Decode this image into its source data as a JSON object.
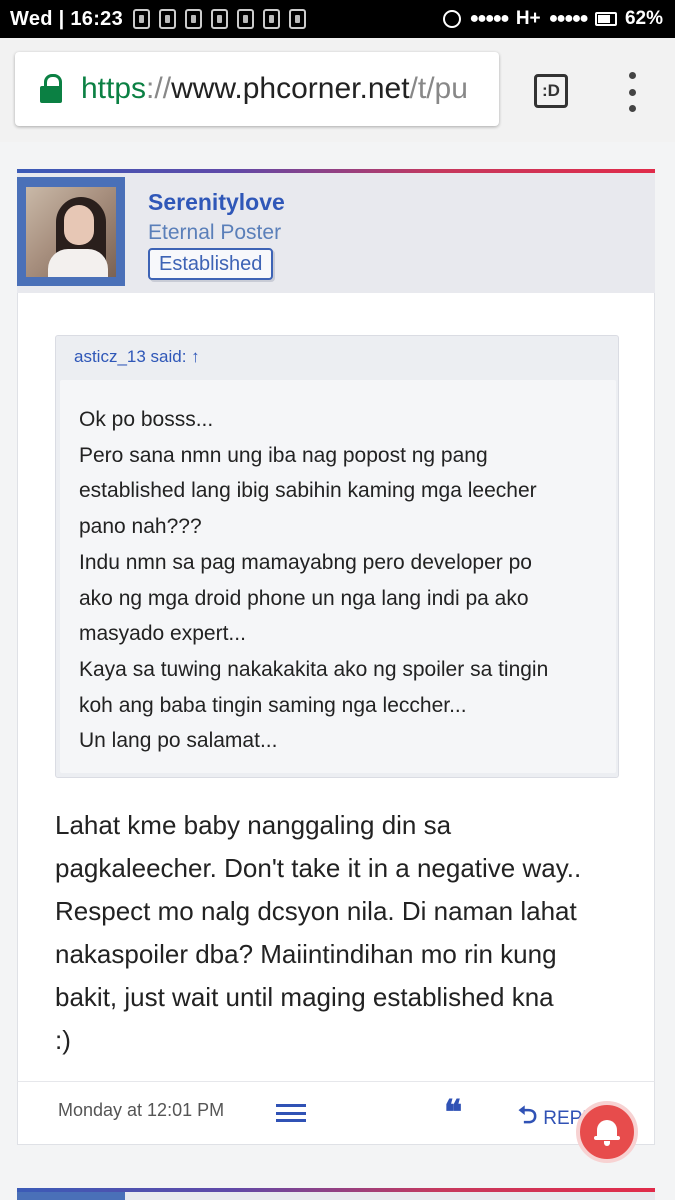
{
  "status_bar": {
    "time": "Wed | 16:23",
    "network": "H+",
    "battery": "62%"
  },
  "browser": {
    "url_scheme": "https",
    "url_sep": "://",
    "url_host": "www.phcorner.net",
    "url_path": "/t/pu",
    "tabs_label": ":D"
  },
  "post": {
    "author": {
      "name": "Serenitylove",
      "title": "Eternal Poster",
      "badge": "Established"
    },
    "quote": {
      "header": "asticz_13 said: ↑",
      "lines": [
        "Ok po bosss...",
        "Pero sana nmn ung iba nag popost ng pang",
        "established lang ibig sabihin kaming mga leecher",
        "pano nah???",
        "Indu nmn sa pag mamayabng pero developer po",
        "ako ng mga droid phone un nga lang indi pa ako",
        "masyado expert...",
        "Kaya sa tuwing nakakakita ako ng spoiler sa tingin",
        "koh ang baba tingin saming nga leccher...",
        "Un lang po salamat..."
      ]
    },
    "message_lines": [
      "Lahat kme baby nanggaling din sa",
      "pagkaleecher. Don't take it in a negative way..",
      "Respect mo nalg dcsyon nila. Di naman lahat",
      "nakaspoiler dba? Maiintindihan mo rin kung",
      "bakit, just wait until maging established kna",
      ":)"
    ],
    "footer": {
      "timestamp": "Monday at 12:01 PM",
      "quote_icon": "❝",
      "reply_label": "REPLY"
    }
  },
  "icons": [
    "lock-icon",
    "tabs-icon",
    "overflow-menu-icon",
    "hamburger-icon",
    "quote-icon",
    "reply-arrow-icon",
    "bell-icon"
  ],
  "colors": {
    "brand_blue": "#2f57b8",
    "secure_green": "#0b8043",
    "notification_red": "#e74c4c"
  }
}
